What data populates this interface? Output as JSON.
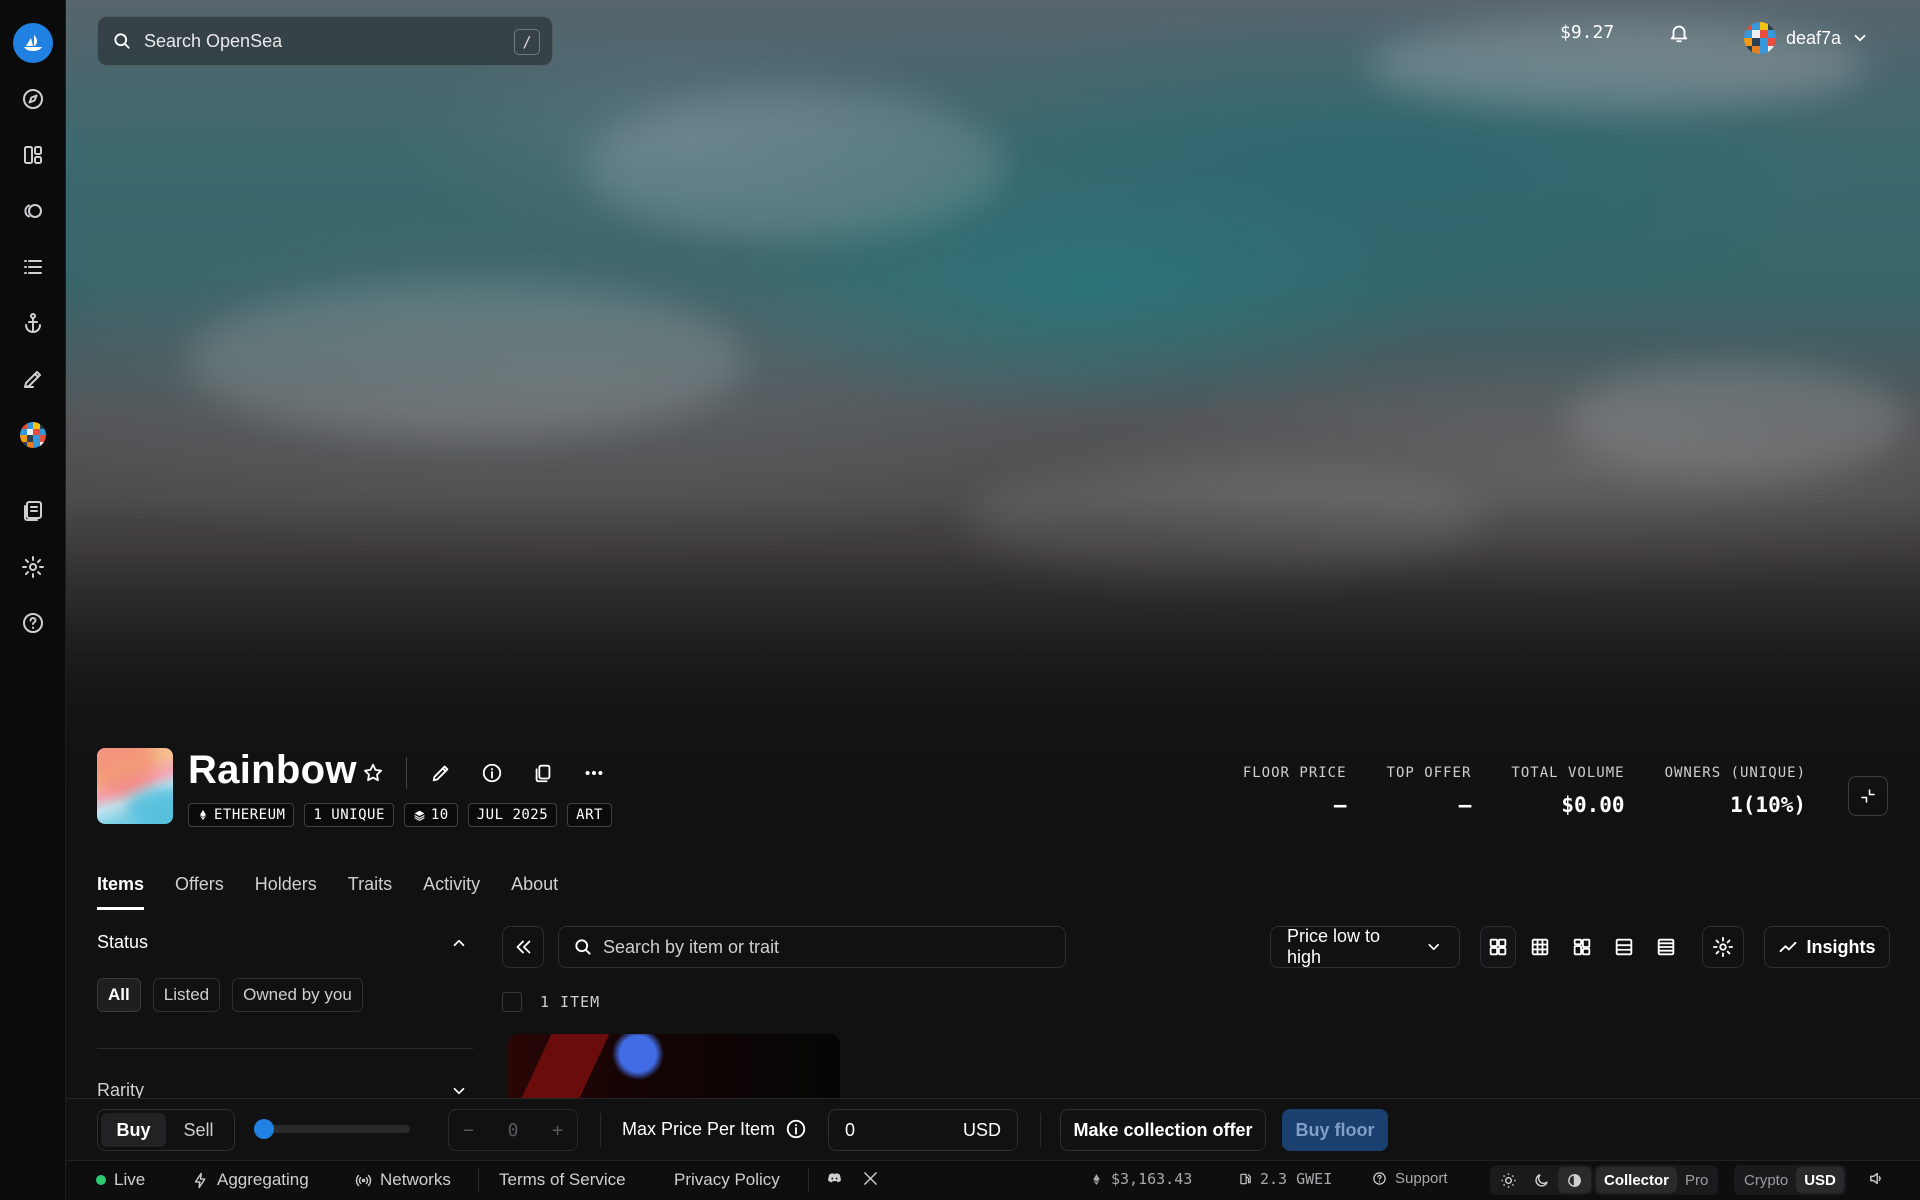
{
  "topbar": {
    "search_placeholder": "Search OpenSea",
    "search_shortcut": "/",
    "balance": "$9.27",
    "username": "deaf7a"
  },
  "collection": {
    "name": "Rainbow",
    "tags": [
      "ETHEREUM",
      "1 UNIQUE",
      "10",
      "JUL 2025",
      "ART"
    ],
    "stats": [
      {
        "label": "FLOOR PRICE",
        "value": "–"
      },
      {
        "label": "TOP OFFER",
        "value": "–"
      },
      {
        "label": "TOTAL VOLUME",
        "value": "$0.00"
      },
      {
        "label": "OWNERS (UNIQUE)",
        "value": "1(10%)"
      }
    ]
  },
  "tabs": [
    "Items",
    "Offers",
    "Holders",
    "Traits",
    "Activity",
    "About"
  ],
  "filters": {
    "status_title": "Status",
    "status_options": [
      "All",
      "Listed",
      "Owned by you"
    ],
    "rarity_title": "Rarity"
  },
  "items": {
    "search_placeholder": "Search by item or trait",
    "sort_label": "Price low to high",
    "insights_label": "Insights",
    "count_label": "1 ITEM"
  },
  "actionbar": {
    "buy_label": "Buy",
    "sell_label": "Sell",
    "stepper_minus": "−",
    "stepper_value": "0",
    "stepper_plus": "+",
    "max_price_label": "Max Price Per Item",
    "price_value": "0",
    "price_currency": "USD",
    "offer_label": "Make collection offer",
    "floor_label": "Buy floor"
  },
  "footer": {
    "live": "Live",
    "aggregating": "Aggregating",
    "networks": "Networks",
    "terms": "Terms of Service",
    "privacy": "Privacy Policy",
    "eth_price": "$3,163.43",
    "gas": "2.3 GWEI",
    "support": "Support",
    "mode_collector": "Collector",
    "mode_pro": "Pro",
    "currency_crypto": "Crypto",
    "currency_usd": "USD"
  },
  "colors": {
    "accent": "#2081e2",
    "live": "#2ecc71",
    "background": "#111112"
  }
}
